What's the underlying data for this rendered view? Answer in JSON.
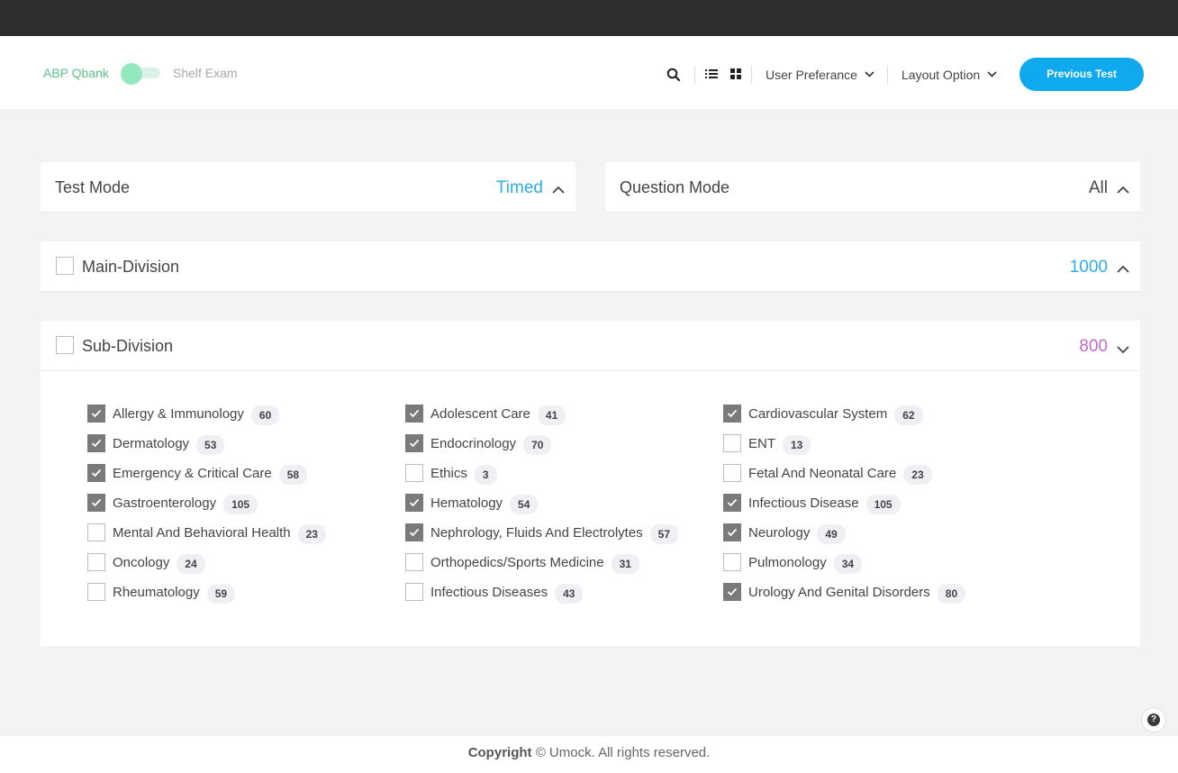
{
  "header": {
    "toggle_left_label": "ABP Qbank",
    "toggle_right_label": "Shelf Exam",
    "menu_user_preference": "User Preferance",
    "menu_layout_option": "Layout Option",
    "previous_test_label": "Previous Test"
  },
  "test_mode": {
    "title": "Test Mode",
    "value": "Timed",
    "value_color": "#2eaee6"
  },
  "question_mode": {
    "title": "Question Mode",
    "value": "All"
  },
  "main_division": {
    "title": "Main-Division",
    "count": "1000",
    "count_color": "#2eaee6",
    "checked": false
  },
  "sub_division": {
    "title": "Sub-Division",
    "count": "800",
    "count_color": "#c06bd0",
    "checked": false,
    "columns": [
      [
        {
          "label": "Allergy & Immunology",
          "count": "60",
          "checked": true
        },
        {
          "label": "Dermatology",
          "count": "53",
          "checked": true
        },
        {
          "label": "Emergency & Critical Care",
          "count": "58",
          "checked": true
        },
        {
          "label": "Gastroenterology",
          "count": "105",
          "checked": true
        },
        {
          "label": "Mental And Behavioral Health",
          "count": "23",
          "checked": false
        },
        {
          "label": "Oncology",
          "count": "24",
          "checked": false
        },
        {
          "label": "Rheumatology",
          "count": "59",
          "checked": false
        }
      ],
      [
        {
          "label": "Adolescent Care",
          "count": "41",
          "checked": true
        },
        {
          "label": "Endocrinology",
          "count": "70",
          "checked": true
        },
        {
          "label": "Ethics",
          "count": "3",
          "checked": false
        },
        {
          "label": "Hematology",
          "count": "54",
          "checked": true
        },
        {
          "label": "Nephrology, Fluids And Electrolytes",
          "count": "57",
          "checked": true
        },
        {
          "label": "Orthopedics/Sports Medicine",
          "count": "31",
          "checked": false
        },
        {
          "label": "Infectious Diseases",
          "count": "43",
          "checked": false
        }
      ],
      [
        {
          "label": "Cardiovascular System",
          "count": "62",
          "checked": true
        },
        {
          "label": "ENT",
          "count": "13",
          "checked": false
        },
        {
          "label": "Fetal And Neonatal Care",
          "count": "23",
          "checked": false
        },
        {
          "label": "Infectious Disease",
          "count": "105",
          "checked": true
        },
        {
          "label": "Neurology",
          "count": "49",
          "checked": true
        },
        {
          "label": "Pulmonology",
          "count": "34",
          "checked": false
        },
        {
          "label": "Urology And Genital Disorders",
          "count": "80",
          "checked": true
        }
      ]
    ]
  },
  "footer": {
    "copyright_label": "Copyright",
    "copyright_text": "© Umock. All rights reserved."
  },
  "help_label": "?"
}
